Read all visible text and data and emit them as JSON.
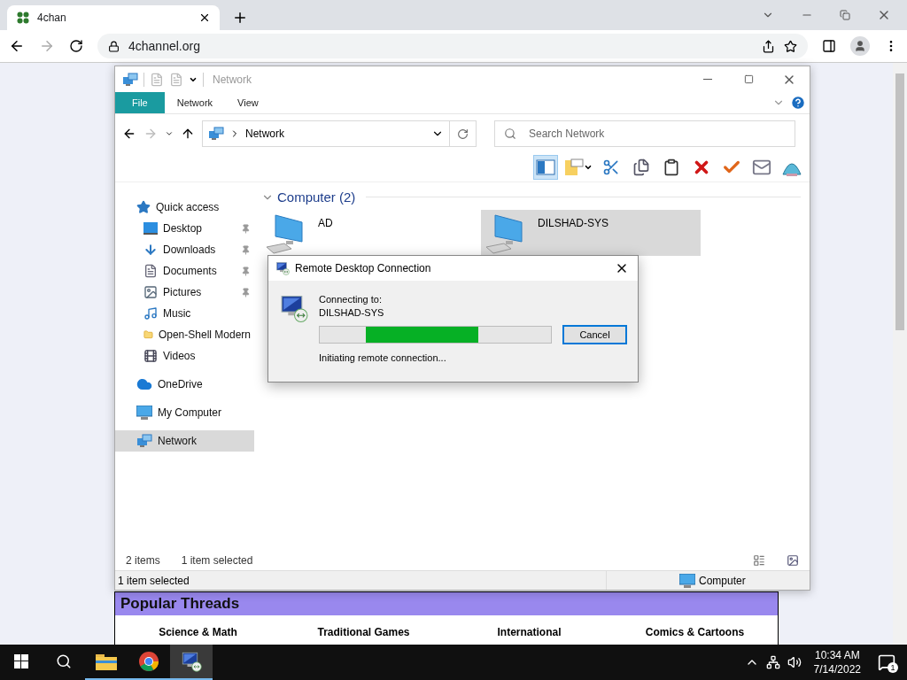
{
  "browser": {
    "tab": {
      "title": "4chan"
    },
    "url": "4channel.org"
  },
  "page": {
    "popular_threads": {
      "title": "Popular Threads",
      "categories": [
        "Science & Math",
        "Traditional Games",
        "International",
        "Comics & Cartoons"
      ]
    }
  },
  "explorer": {
    "title": "Network",
    "ribbon_tabs": [
      {
        "label": "File",
        "selected": true
      },
      {
        "label": "Network",
        "selected": false
      },
      {
        "label": "View",
        "selected": false
      }
    ],
    "address": "Network",
    "search": {
      "placeholder": "Search Network"
    },
    "toolbar": [
      {
        "kind": "pane",
        "selected": true
      },
      {
        "kind": "note",
        "selected": false
      },
      {
        "kind": "cut",
        "selected": false
      },
      {
        "kind": "copy",
        "selected": false
      },
      {
        "kind": "paste",
        "selected": false
      },
      {
        "kind": "delete",
        "selected": false
      },
      {
        "kind": "check",
        "selected": false
      },
      {
        "kind": "envelope",
        "selected": false
      },
      {
        "kind": "shell",
        "selected": false
      }
    ],
    "nav": [
      {
        "label": "Quick access",
        "kind": "star",
        "selected": false,
        "children": [
          {
            "label": "Desktop",
            "kind": "desktop",
            "pinned": true,
            "selected": false
          },
          {
            "label": "Downloads",
            "kind": "downloads",
            "pinned": true,
            "selected": false
          },
          {
            "label": "Documents",
            "kind": "documents",
            "pinned": true,
            "selected": false
          },
          {
            "label": "Pictures",
            "kind": "pictures",
            "pinned": true,
            "selected": false
          },
          {
            "label": "Music",
            "kind": "music",
            "pinned": false,
            "selected": false
          },
          {
            "label": "Open-Shell Modern",
            "kind": "folder",
            "pinned": false,
            "selected": false
          },
          {
            "label": "Videos",
            "kind": "videos",
            "pinned": false,
            "selected": false
          }
        ]
      },
      {
        "label": "OneDrive",
        "kind": "cloud",
        "selected": false
      },
      {
        "label": "My Computer",
        "kind": "computer",
        "selected": false
      },
      {
        "label": "Network",
        "kind": "network",
        "selected": true
      }
    ],
    "group": {
      "label": "Computer (2)",
      "expanded": true,
      "items": [
        {
          "name": "AD",
          "selected": false
        },
        {
          "name": "DILSHAD-SYS",
          "selected": true
        }
      ]
    },
    "item_count": "2 items",
    "selection_info": "1 item selected",
    "status_bar": {
      "left": "1 item selected",
      "right": "Computer"
    }
  },
  "dialog": {
    "title": "Remote Desktop Connection",
    "label": "Connecting to:",
    "host": "DILSHAD-SYS",
    "status": "Initiating remote connection...",
    "button": "Cancel"
  },
  "taskbar": {
    "apps": [
      {
        "kind": "explorer",
        "selected": false
      },
      {
        "kind": "chrome",
        "selected": false
      },
      {
        "kind": "rdp",
        "selected": true
      }
    ],
    "time": "10:34 AM",
    "date": "7/14/2022",
    "notifications": "1"
  }
}
